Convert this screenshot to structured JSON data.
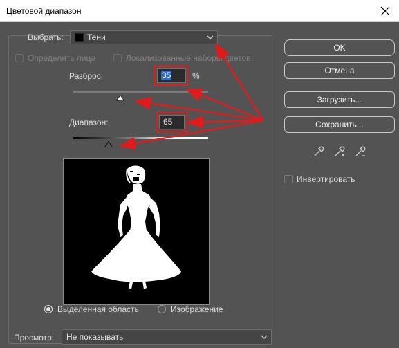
{
  "window": {
    "title": "Цветовой диапазон"
  },
  "select": {
    "label": "Выбрать:",
    "value": "Тени"
  },
  "options": {
    "detect_faces": "Определять лица",
    "localized": "Локализованные наборы цветов"
  },
  "fuzziness": {
    "label": "Разброс:",
    "value": "35",
    "unit": "%",
    "level": 0.35
  },
  "range": {
    "label": "Диапазон:",
    "value": "65",
    "level": 0.26
  },
  "selection": {
    "selection_label": "Выделенная область",
    "image_label": "Изображение",
    "selected": "selection"
  },
  "preview": {
    "label": "Просмотр:",
    "value": "Не показывать"
  },
  "buttons": {
    "ok": "OK",
    "cancel": "Отмена",
    "load": "Загрузить...",
    "save": "Сохранить..."
  },
  "invert": {
    "label": "Инвертировать",
    "checked": false
  },
  "colors": {
    "highlight": "#e11b1b",
    "arrow": "#e11b1b",
    "panel": "#535353"
  },
  "icons": [
    "close-icon",
    "chevron-down-icon",
    "eyedropper-icon",
    "eyedropper-plus-icon",
    "eyedropper-minus-icon",
    "slider-thumb-icon"
  ]
}
